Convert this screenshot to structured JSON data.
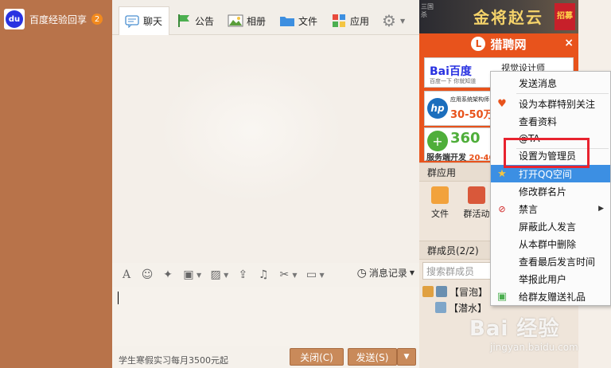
{
  "sidebar": {
    "conversation": {
      "avatar_text": "du",
      "name": "百度经验回享",
      "badge": "2"
    }
  },
  "tabs": [
    {
      "label": "聊天",
      "icon": "chat-bubble-icon"
    },
    {
      "label": "公告",
      "icon": "flag-icon"
    },
    {
      "label": "相册",
      "icon": "photo-icon"
    },
    {
      "label": "文件",
      "icon": "folder-icon"
    },
    {
      "label": "应用",
      "icon": "apps-grid-icon"
    }
  ],
  "toolbar": {
    "history_label": "消息记录"
  },
  "footer": {
    "notice": "学生寒假实习每月3500元起",
    "close_label": "关闭(C)",
    "send_label": "发送(S)"
  },
  "banner": {
    "title": "金将赵云",
    "badge": "招募",
    "side_text": "三国杀"
  },
  "ad": {
    "brand": "猎聘网",
    "close": "×",
    "cards": [
      {
        "company": "Bai百度",
        "company_sub": "百度一下 你就知道",
        "title": "视觉设计师"
      },
      {
        "company": "hp",
        "title": "应用系统架构师",
        "salary": "30-50万"
      },
      {
        "company": "360",
        "title": "服务端开发",
        "salary": "20-40万"
      }
    ]
  },
  "group_apps": {
    "title": "群应用",
    "items": [
      {
        "label": "文件"
      },
      {
        "label": "群活动"
      }
    ]
  },
  "members": {
    "title": "群成员(2/2)",
    "search_placeholder": "搜索群成员",
    "rows": [
      "【冒泡】",
      "【潜水】"
    ]
  },
  "context_menu": {
    "items": [
      "发送消息",
      "设为本群特别关注",
      "查看资料",
      "@TA",
      "设置为管理员",
      "打开QQ空间",
      "修改群名片",
      "禁言",
      "屏蔽此人发言",
      "从本群中删除",
      "查看最后发言时间",
      "举报此用户",
      "给群友赠送礼品"
    ]
  },
  "watermark": {
    "main": "Bai 经验",
    "sub": "jingyan.baidu.com"
  },
  "colors": {
    "sidebar": "#b8734a",
    "accent": "#e8531c",
    "menu_highlight": "#3c8fe3",
    "red_box": "#e8232f"
  }
}
